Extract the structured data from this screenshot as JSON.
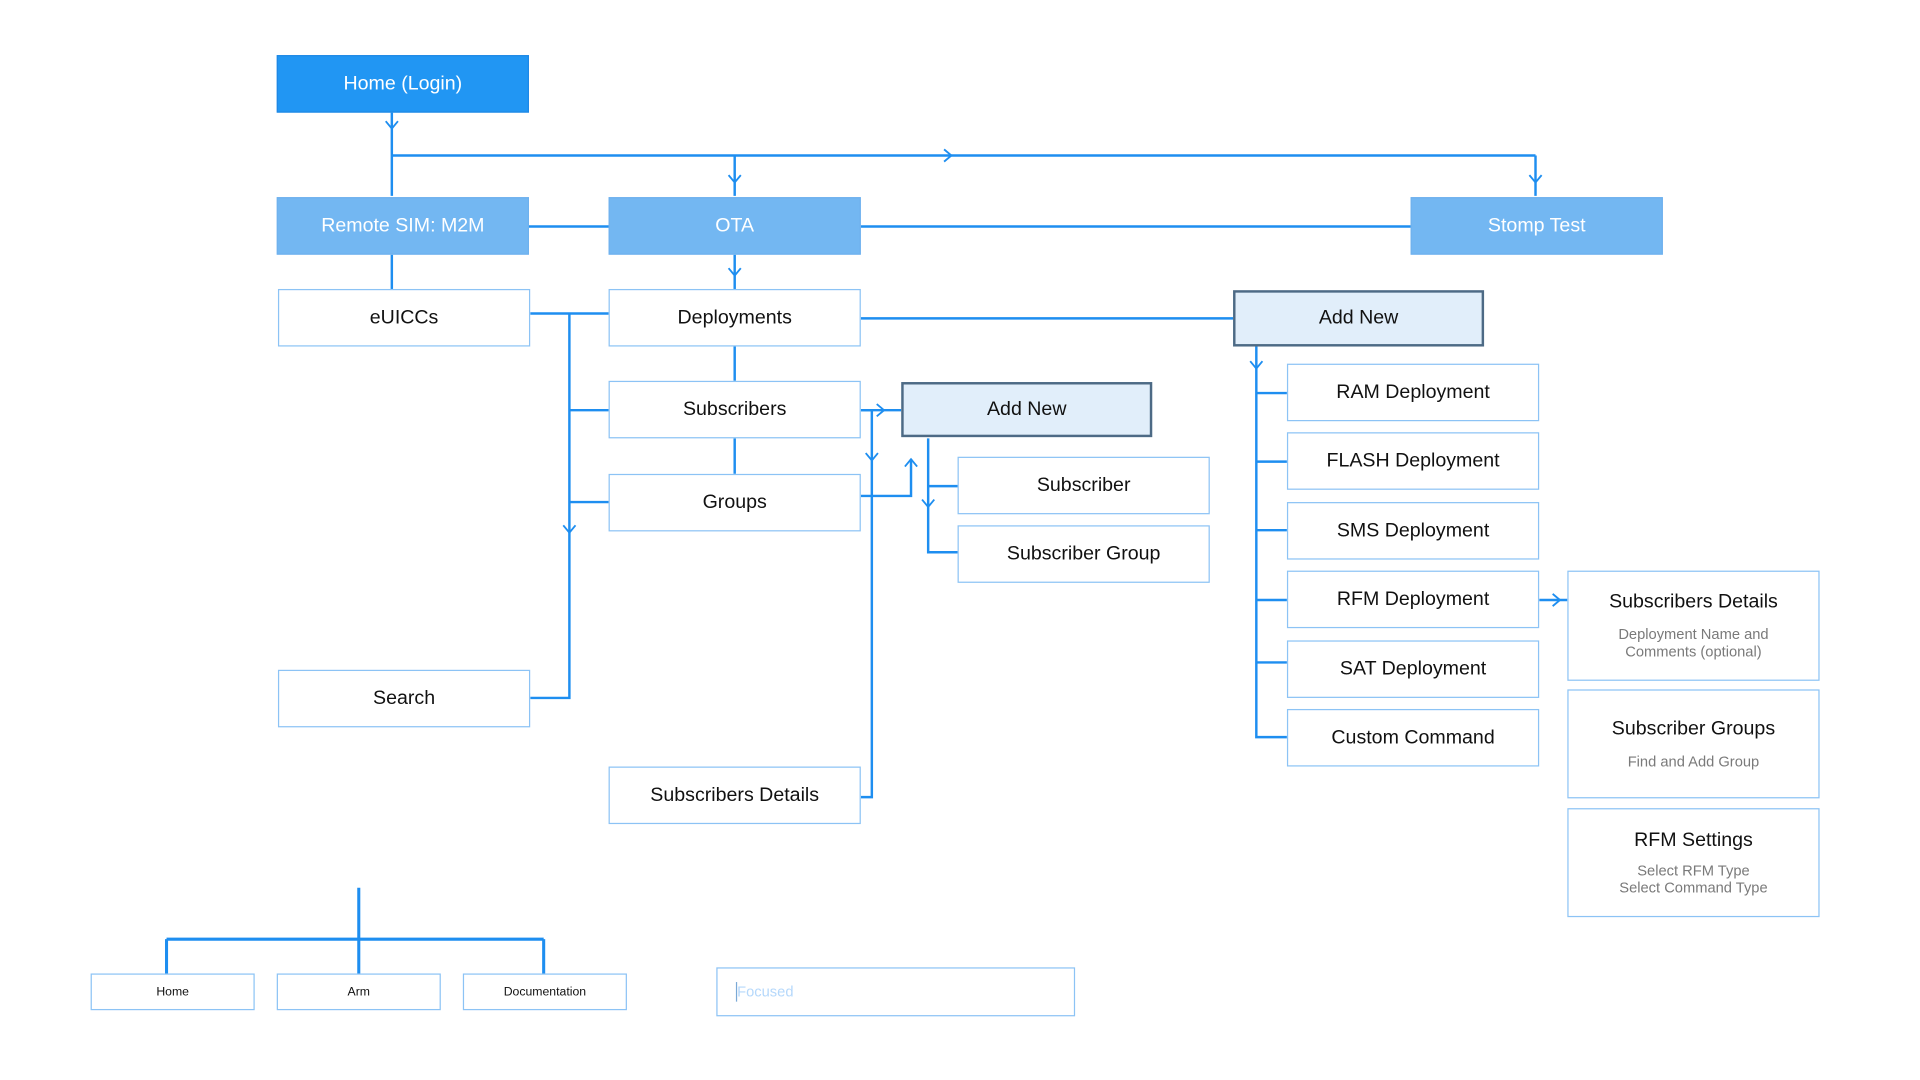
{
  "colors": {
    "primary": "#2196f3",
    "secondary": "#73b7f2",
    "line": "#1e8ef0",
    "border": "#8cc3f5",
    "highlight_fill": "#e1eefa",
    "highlight_border": "#4d6a85"
  },
  "nodes": {
    "home": "Home (Login)",
    "remote_sim": "Remote SIM: M2M",
    "ota": "OTA",
    "stomp": "Stomp Test",
    "euiccs": "eUICCs",
    "deployments": "Deployments",
    "add_new_deployment": "Add New",
    "subscribers": "Subscribers",
    "add_new_subscriber": "Add New",
    "groups": "Groups",
    "subscriber": "Subscriber",
    "subscriber_group": "Subscriber Group",
    "search": "Search",
    "subscribers_details": "Subscribers Details",
    "ram": "RAM Deployment",
    "flash": "FLASH Deployment",
    "sms": "SMS Deployment",
    "rfm": "RFM Deployment",
    "sat": "SAT Deployment",
    "custom": "Custom Command"
  },
  "detail_cards": [
    {
      "title": "Subscribers Details",
      "lines": [
        "Deployment Name and",
        "Comments (optional)"
      ]
    },
    {
      "title": "Subscriber Groups",
      "lines": [
        "Find and Add Group"
      ]
    },
    {
      "title": "RFM Settings",
      "lines": [
        "Select RFM Type",
        "Select Command Type"
      ]
    }
  ],
  "bottom_nav": [
    "Home",
    "Arm",
    "Documentation"
  ],
  "input": {
    "placeholder": "Focused"
  }
}
